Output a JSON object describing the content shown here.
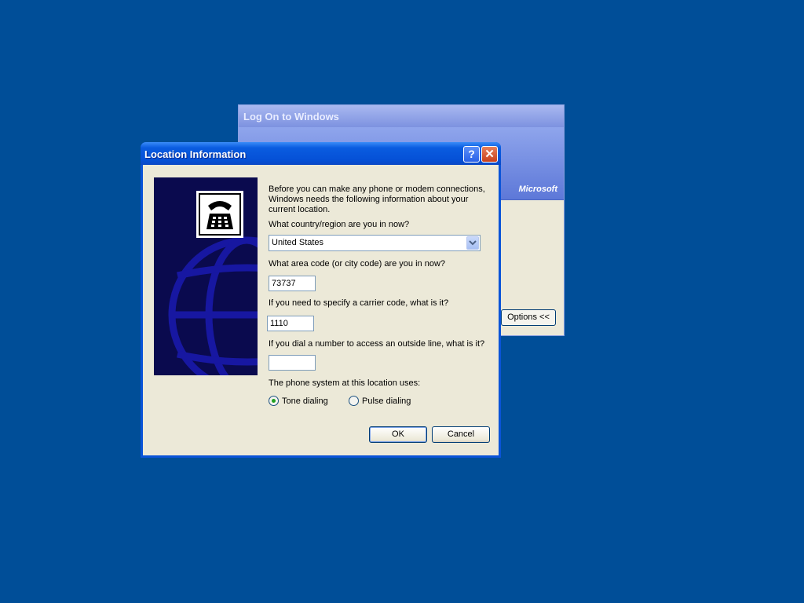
{
  "logon": {
    "title": "Log On to Windows",
    "brand": "Microsoft",
    "options_label": "Options <<"
  },
  "dialog": {
    "title": "Location Information",
    "help_label": "?",
    "close_label": "✕",
    "intro": "Before you can make any phone or modem connections, Windows needs the following information about your current location.",
    "country_label": "What country/region are you in now?",
    "country_value": "United States",
    "area_code_label": "What area code (or city code) are you in now?",
    "area_code_value": "73737",
    "carrier_label": "If you need to specify a carrier code, what is it?",
    "carrier_value": "1110",
    "outside_line_label": "If you dial a number to access an outside line, what is it?",
    "outside_line_value": "",
    "phone_system_label": "The phone system at this location uses:",
    "tone_label": "Tone dialing",
    "pulse_label": "Pulse dialing",
    "tone_selected": true,
    "ok_label": "OK",
    "cancel_label": "Cancel"
  },
  "icons": {
    "graphic": "globe-telephone-icon",
    "telephone": "telephone-icon",
    "dropdown": "chevron-down-icon"
  }
}
